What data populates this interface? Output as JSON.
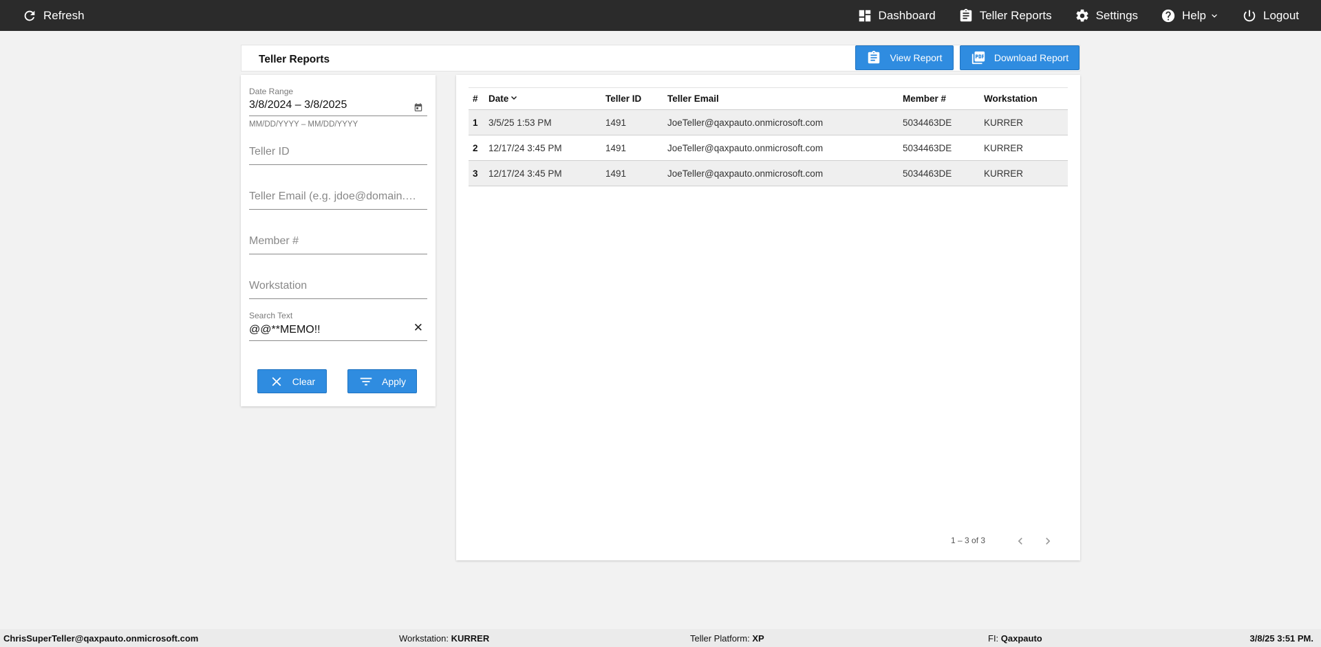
{
  "nav": {
    "refresh": "Refresh",
    "dashboard": "Dashboard",
    "teller_reports": "Teller Reports",
    "settings": "Settings",
    "help": "Help",
    "logout": "Logout"
  },
  "page": {
    "title": "Teller Reports",
    "view_report": "View Report",
    "download_report": "Download Report"
  },
  "filters": {
    "date_range_label": "Date Range",
    "date_range_value": "3/8/2024 – 3/8/2025",
    "date_range_hint": "MM/DD/YYYY – MM/DD/YYYY",
    "teller_id_placeholder": "Teller ID",
    "teller_email_placeholder": "Teller Email (e.g. jdoe@domain.com)",
    "member_placeholder": "Member #",
    "workstation_placeholder": "Workstation",
    "search_label": "Search Text",
    "search_value": "@@**MEMO!!",
    "clear": "Clear",
    "apply": "Apply"
  },
  "table": {
    "columns": [
      "#",
      "Date",
      "Teller ID",
      "Teller Email",
      "Member #",
      "Workstation"
    ],
    "rows": [
      {
        "n": "1",
        "date": "3/5/25 1:53 PM",
        "teller_id": "1491",
        "email": "JoeTeller@qaxpauto.onmicrosoft.com",
        "member": "5034463DE",
        "workstation": "KURRER"
      },
      {
        "n": "2",
        "date": "12/17/24 3:45 PM",
        "teller_id": "1491",
        "email": "JoeTeller@qaxpauto.onmicrosoft.com",
        "member": "5034463DE",
        "workstation": "KURRER"
      },
      {
        "n": "3",
        "date": "12/17/24 3:45 PM",
        "teller_id": "1491",
        "email": "JoeTeller@qaxpauto.onmicrosoft.com",
        "member": "5034463DE",
        "workstation": "KURRER"
      }
    ],
    "pagination": "1 – 3 of 3"
  },
  "status": {
    "user": "ChrisSuperTeller@qaxpauto.onmicrosoft.com",
    "workstation_label": "Workstation: ",
    "workstation_value": "KURRER",
    "platform_label": "Teller Platform: ",
    "platform_value": "XP",
    "fi_label": "FI: ",
    "fi_value": "Qaxpauto",
    "datetime": "3/8/25 3:51 PM."
  }
}
